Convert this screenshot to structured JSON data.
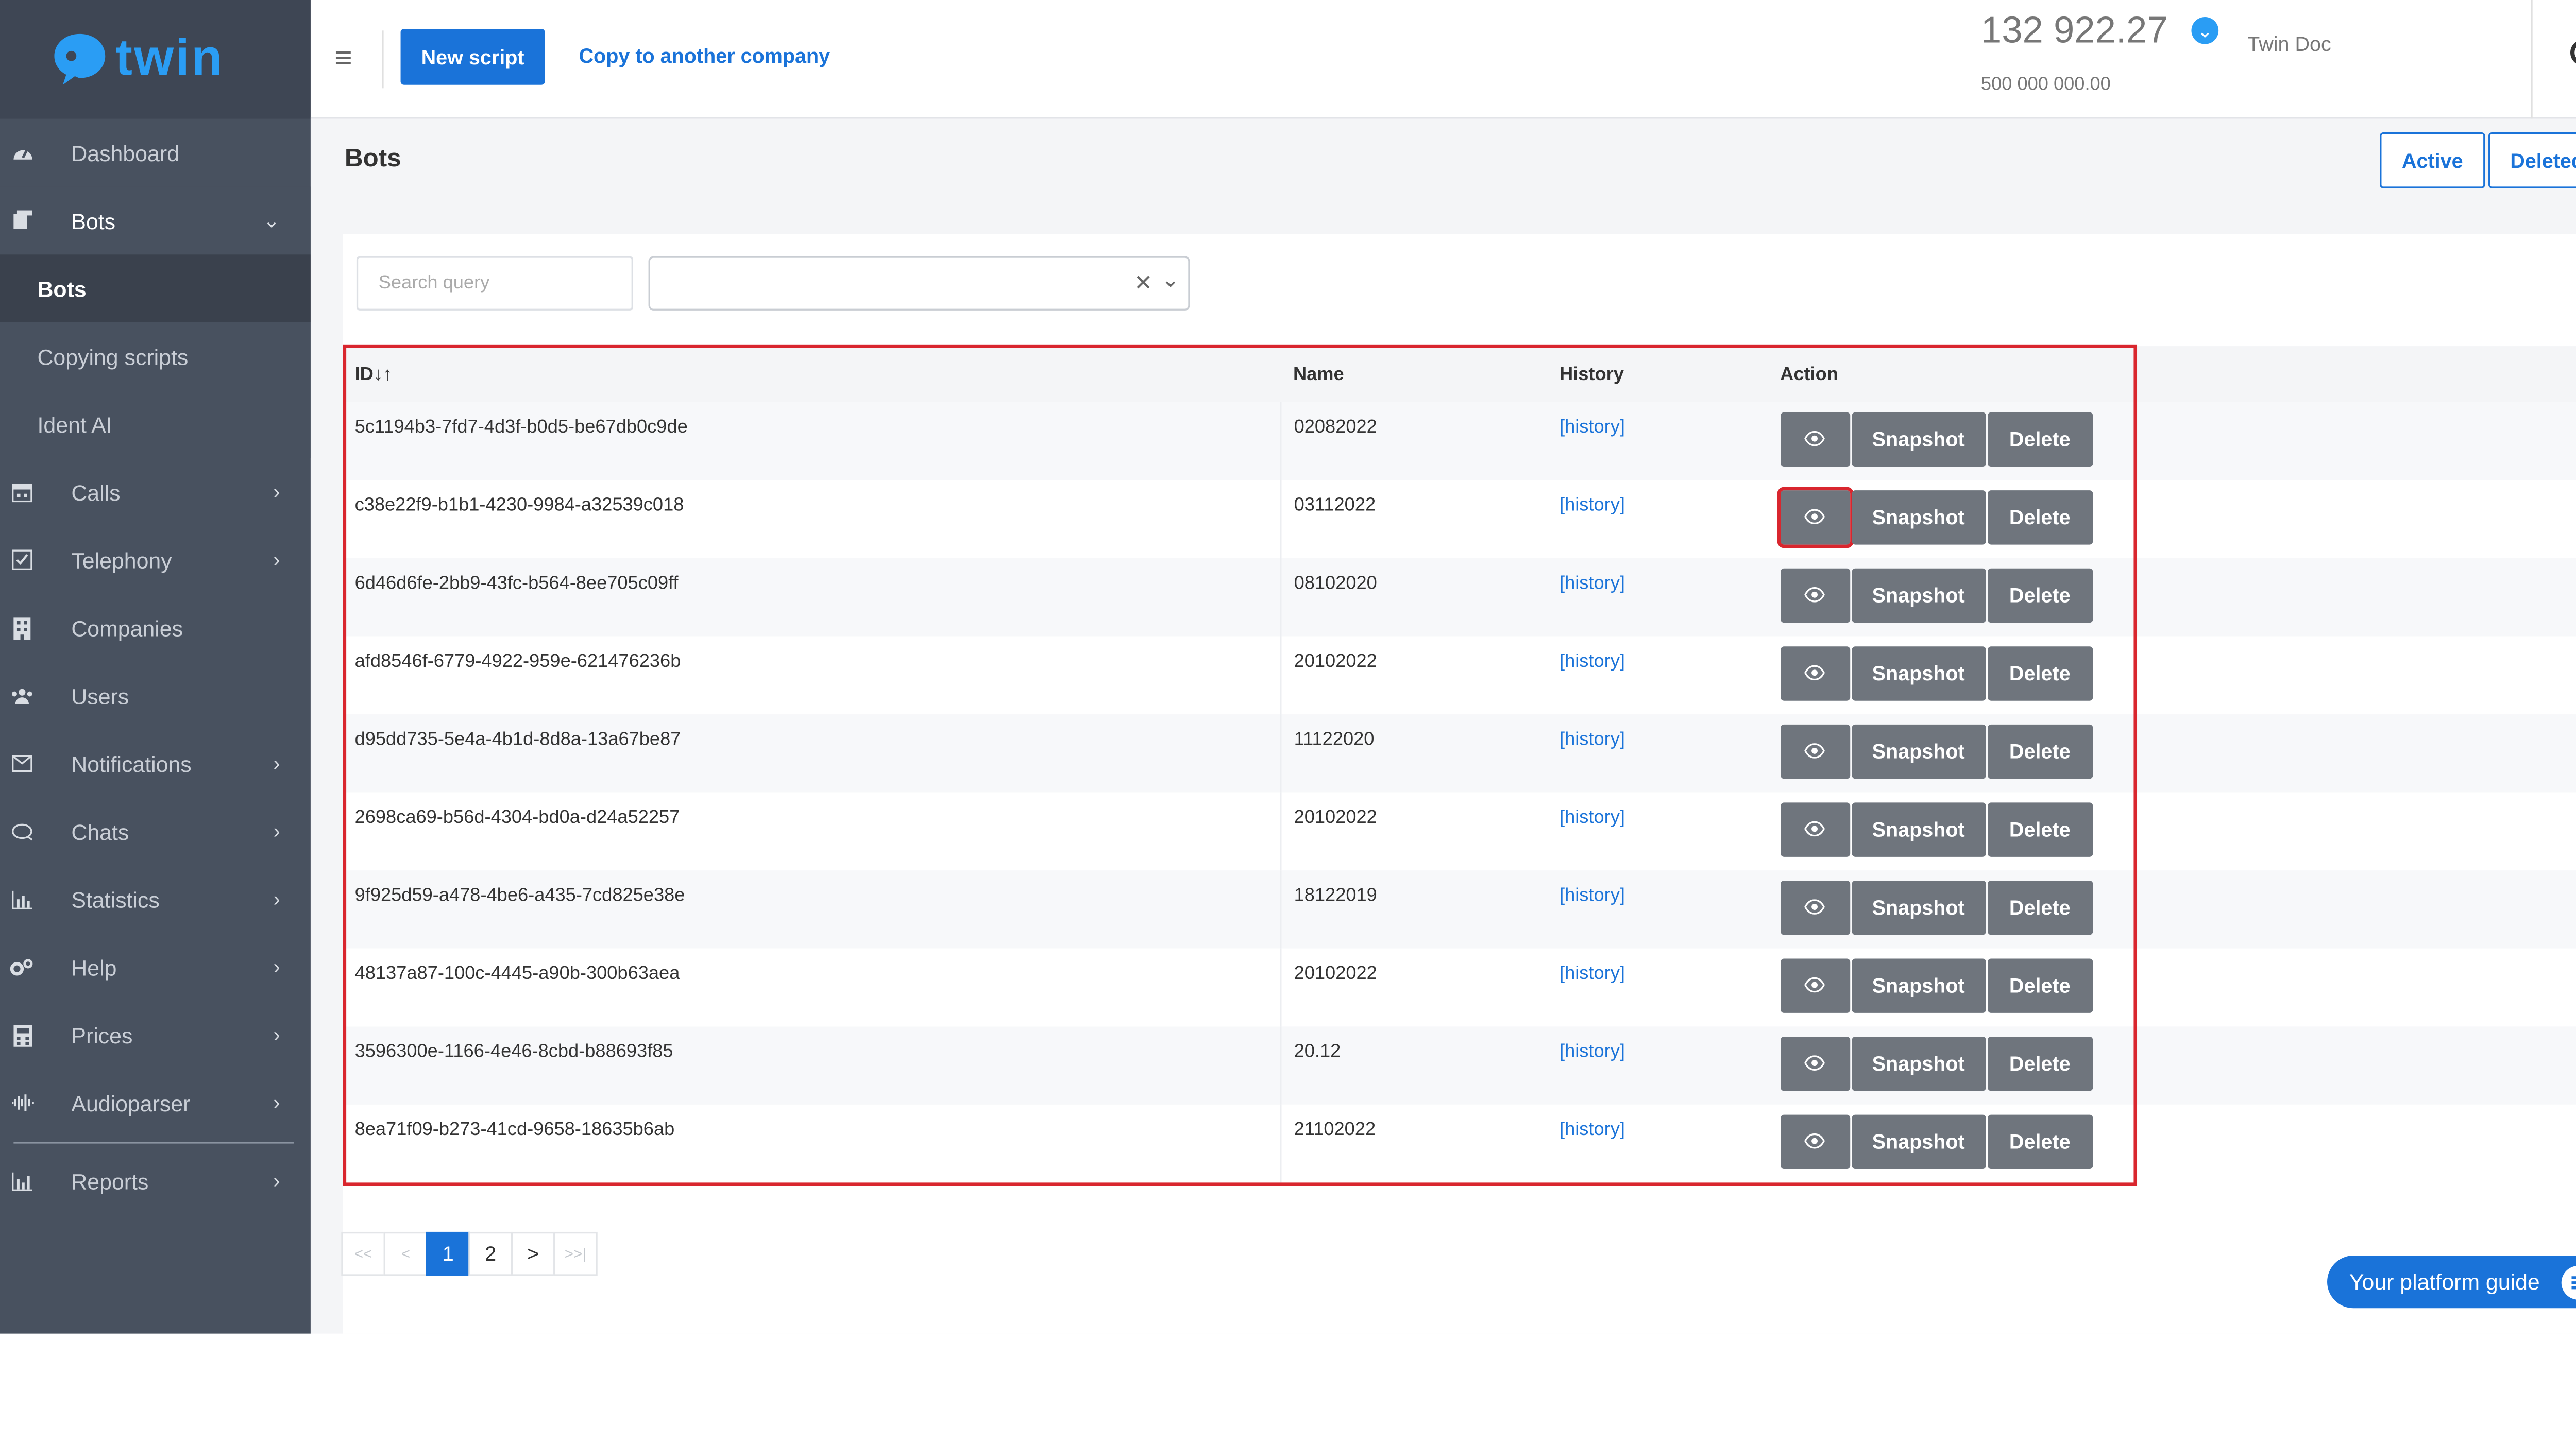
{
  "logo": {
    "text": "twin"
  },
  "sidebar": {
    "items": [
      {
        "label": "Dashboard",
        "icon": "dashboard-icon"
      },
      {
        "label": "Bots",
        "icon": "bots-icon",
        "open": true,
        "subitems": [
          {
            "label": "Bots",
            "active": true
          },
          {
            "label": "Copying scripts"
          },
          {
            "label": "Ident AI"
          }
        ]
      },
      {
        "label": "Calls",
        "icon": "calendar-icon"
      },
      {
        "label": "Telephony",
        "icon": "telephony-icon"
      },
      {
        "label": "Companies",
        "icon": "building-icon"
      },
      {
        "label": "Users",
        "icon": "users-icon"
      },
      {
        "label": "Notifications",
        "icon": "envelope-icon"
      },
      {
        "label": "Chats",
        "icon": "chat-icon"
      },
      {
        "label": "Statistics",
        "icon": "chart-icon"
      },
      {
        "label": "Help",
        "icon": "gears-icon"
      },
      {
        "label": "Prices",
        "icon": "calculator-icon"
      },
      {
        "label": "Audioparser",
        "icon": "waveform-icon"
      },
      {
        "label": "Reports",
        "icon": "report-icon"
      }
    ]
  },
  "topbar": {
    "new_script": "New script",
    "copy_link": "Copy to another company",
    "balance": "132 922.27",
    "limit": "500 000 000.00",
    "user": "Twin Doc"
  },
  "page": {
    "title": "Bots",
    "filter_active": "Active",
    "filter_deleted": "Deleted",
    "search_placeholder": "Search query"
  },
  "table": {
    "headers": {
      "id": "ID",
      "name": "Name",
      "history": "History",
      "action": "Action"
    },
    "rows": [
      {
        "id": "5c1194b3-7fd7-4d3f-b0d5-be67db0c9de",
        "name": "02082022"
      },
      {
        "id": "c38e22f9-b1b1-4230-9984-a32539c018",
        "name": "03112022"
      },
      {
        "id": "6d46d6fe-2bb9-43fc-b564-8ee705c09ff",
        "name": "08102020"
      },
      {
        "id": "afd8546f-6779-4922-959e-621476236b",
        "name": "20102022"
      },
      {
        "id": "d95dd735-5e4a-4b1d-8d8a-13a67be87",
        "name": "11122020"
      },
      {
        "id": "2698ca69-b56d-4304-bd0a-d24a52257",
        "name": "20102022"
      },
      {
        "id": "9f925d59-a478-4be6-a435-7cd825e38e",
        "name": "18122019"
      },
      {
        "id": "48137a87-100c-4445-a90b-300b63aea",
        "name": "20102022"
      },
      {
        "id": "3596300e-1166-4e46-8cbd-b88693f85",
        "name": "20.12"
      },
      {
        "id": "8ea71f09-b273-41cd-9658-18635b6ab",
        "name": "21102022"
      }
    ],
    "history_label": "[history]",
    "snapshot_label": "Snapshot",
    "delete_label": "Delete"
  },
  "pager": {
    "first": "<<",
    "prev": "<",
    "page1": "1",
    "page2": "2",
    "next": ">",
    "last": ">>|"
  },
  "guide": {
    "label": "Your platform guide"
  },
  "colors": {
    "accent": "#1a73d9",
    "sidebar": "#48515f",
    "highlight": "#d9262e",
    "action_button": "#6f757d"
  }
}
